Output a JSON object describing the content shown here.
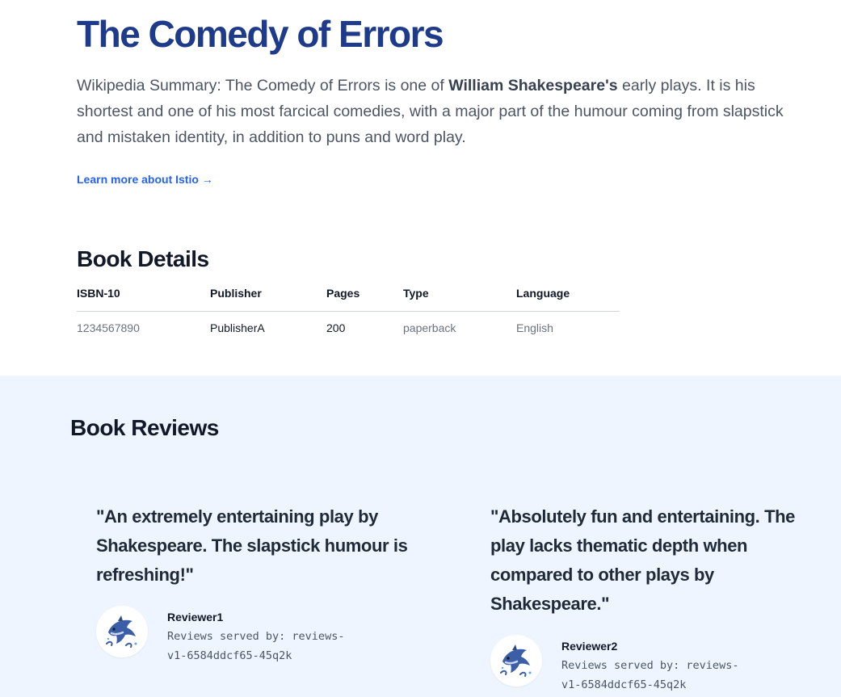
{
  "product": {
    "title": "The Comedy of Errors",
    "summary_prefix": "Wikipedia Summary: The Comedy of Errors is one of ",
    "summary_author": "William Shakespeare's",
    "summary_suffix": " early plays. It is his shortest and one of his most farcical comedies, with a major part of the humour coming from slapstick and mistaken identity, in addition to puns and word play.",
    "learn_more": "Learn more about Istio →"
  },
  "details": {
    "heading": "Book Details",
    "columns": [
      "ISBN-10",
      "Publisher",
      "Pages",
      "Type",
      "Language"
    ],
    "row": [
      "1234567890",
      "PublisherA",
      "200",
      "paperback",
      "English"
    ]
  },
  "reviews": {
    "heading": "Book Reviews",
    "items": [
      {
        "text": "\"An extremely entertaining play by Shakespeare. The slapstick humour is refreshing!\"",
        "reviewer": "Reviewer1",
        "served_by": "Reviews served by: reviews-v1-6584ddcf65-45q2k",
        "avatar_icon": "dolphin-icon"
      },
      {
        "text": "\"Absolutely fun and entertaining. The play lacks thematic depth when compared to other plays by Shakespeare.\"",
        "reviewer": "Reviewer2",
        "served_by": "Reviews served by: reviews-v1-6584ddcf65-45q2k",
        "avatar_icon": "dolphin-icon"
      }
    ]
  },
  "colors": {
    "title": "#1e3a8a",
    "link": "#2563eb",
    "reviews_bg": "#eff5fe"
  }
}
